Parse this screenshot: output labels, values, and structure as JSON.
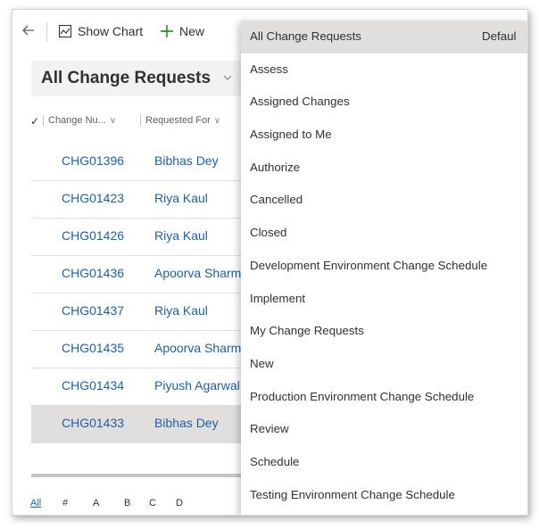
{
  "commandbar": {
    "back_icon": "back-arrow-icon",
    "show_chart_label": "Show Chart",
    "new_label": "New"
  },
  "view": {
    "title": "All Change Requests"
  },
  "grid": {
    "columns": [
      "Change Nu...",
      "Requested For"
    ],
    "rows": [
      {
        "number": "CHG01396",
        "requested_for": "Bibhas Dey",
        "selected": false
      },
      {
        "number": "CHG01423",
        "requested_for": "Riya Kaul",
        "selected": false
      },
      {
        "number": "CHG01426",
        "requested_for": "Riya Kaul",
        "selected": false
      },
      {
        "number": "CHG01436",
        "requested_for": "Apoorva Sharm",
        "selected": false
      },
      {
        "number": "CHG01437",
        "requested_for": "Riya Kaul",
        "selected": false
      },
      {
        "number": "CHG01435",
        "requested_for": "Apoorva Sharm",
        "selected": false
      },
      {
        "number": "CHG01434",
        "requested_for": "Piyush Agarwal",
        "selected": false
      },
      {
        "number": "CHG01433",
        "requested_for": "Bibhas Dey",
        "selected": true
      }
    ]
  },
  "alphabet": [
    "All",
    "#",
    "A",
    "B",
    "C",
    "D"
  ],
  "view_menu": {
    "default_tag": "Defaul",
    "items": [
      "All Change Requests",
      "Assess",
      "Assigned Changes",
      "Assigned to Me",
      "Authorize",
      "Cancelled",
      "Closed",
      "Development Environment Change Schedule",
      "Implement",
      "My Change Requests",
      "New",
      "Production Environment Change Schedule",
      "Review",
      "Schedule",
      "Testing Environment Change Schedule"
    ]
  },
  "colors": {
    "link": "#1f5fa8",
    "accent_green": "#107c10",
    "selected_row": "#e1dfdd"
  }
}
